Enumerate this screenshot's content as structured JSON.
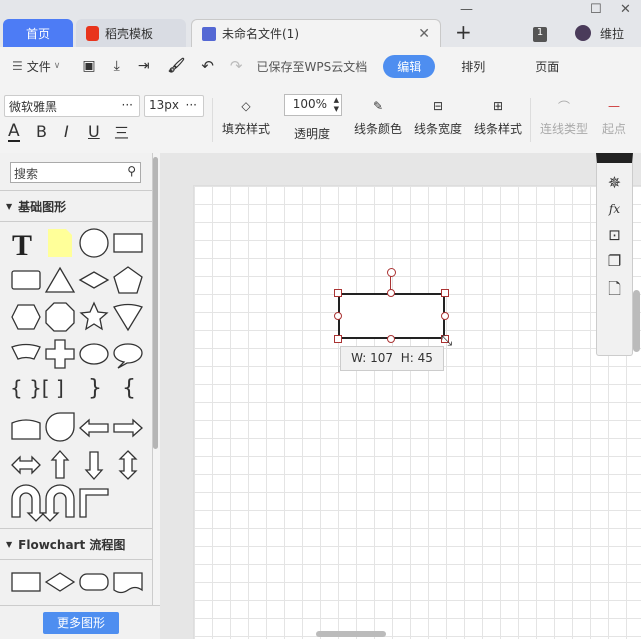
{
  "titlebar": {
    "tabs": [
      {
        "label": "首页"
      },
      {
        "label": "稻壳模板"
      },
      {
        "label": "未命名文件(1)"
      }
    ],
    "new_tab": "+",
    "badge": "1",
    "user": "维拉"
  },
  "toolbar": {
    "file_menu": "文件",
    "save_status": "已保存至WPS云文档",
    "mode_tabs": [
      "编辑",
      "排列",
      "页面"
    ],
    "active_mode": "编辑",
    "font": "微软雅黑",
    "font_size": "13px",
    "more": "···",
    "opacity": "100%",
    "text_styles": [
      "A",
      "B",
      "I",
      "U",
      "三"
    ],
    "buttons": [
      "填充样式",
      "透明度",
      "线条颜色",
      "线条宽度",
      "线条样式",
      "连线类型",
      "起点"
    ]
  },
  "sidebar": {
    "search_placeholder": "搜索",
    "sections": [
      {
        "title": "基础图形"
      },
      {
        "title": "Flowchart 流程图"
      }
    ],
    "more_button": "更多图形"
  },
  "canvas": {
    "shape_size": "W: 107  H: 45"
  },
  "colors": {
    "accent": "#4d7cf5",
    "mode_active": "#4e8ef0",
    "note": "#ffff99"
  }
}
